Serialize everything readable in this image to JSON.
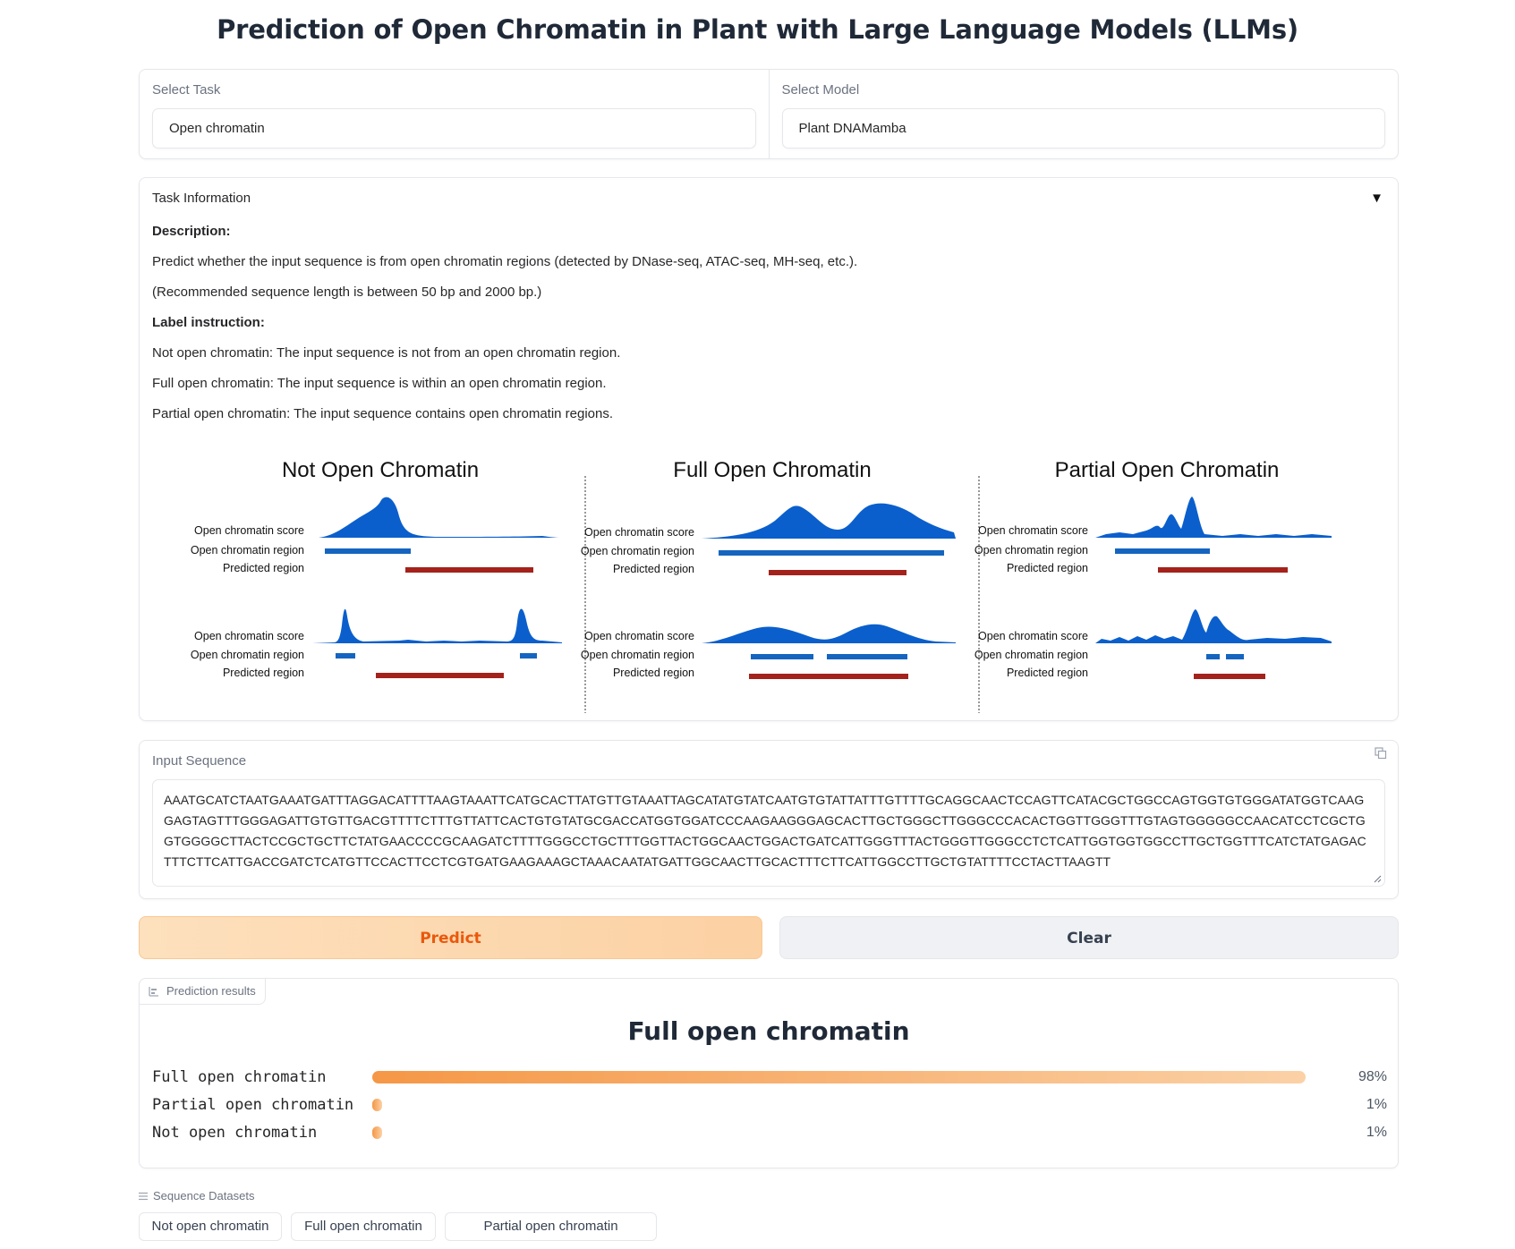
{
  "title": "Prediction of Open Chromatin in Plant with Large Language Models (LLMs)",
  "task_select": {
    "label": "Select Task",
    "value": "Open chromatin"
  },
  "model_select": {
    "label": "Select Model",
    "value": "Plant DNAMamba"
  },
  "task_info": {
    "header": "Task Information",
    "toggle_icon": "triangle-down-icon",
    "description_heading": "Description:",
    "description": "Predict whether the input sequence is from open chromatin regions (detected by DNase-seq, ATAC-seq, MH-seq, etc.).",
    "recommendation": "(Recommended sequence length is between 50 bp and 2000 bp.)",
    "label_heading": "Label instruction:",
    "labels": [
      "Not open chromatin: The input sequence is not from an open chromatin region.",
      "Full open chromatin: The input sequence is within an open chromatin region.",
      "Partial open chromatin: The input sequence contains open chromatin regions."
    ],
    "figure": {
      "panels": [
        "Not Open Chromatin",
        "Full Open Chromatin",
        "Partial Open Chromatin"
      ],
      "track_labels": [
        "Open chromatin score",
        "Open chromatin region",
        "Predicted region"
      ],
      "colors": {
        "score": "#0b5fcc",
        "region": "#1565c0",
        "predicted": "#a4221c"
      }
    }
  },
  "input": {
    "label": "Input Sequence",
    "sequence": "AAATGCATCTAATGAAATGATTTAGGACATTTTAAGTAAATTCATGCACTTATGTTGTAAATTAGCATATGTATCAATGTGTATTATTTGTTTTGCAGGCAACTCCAGTTCATACGCTGGCCAGTGGTGTGGGATATGGTCAAGGAGTAGTTTGGGAGATTGTGTTGACGTTTTCTTTGTTATTCACTGTGTATGCGACCATGGTGGATCCCAAGAAGGGAGCACTTGCTGGGCTTGGGCCCACACTGGTTGGGTTTGTAGTGGGGGCCAACATCCTCGCTGGTGGGGCTTACTCCGCTGCTTCTATGAACCCCGCAAGATCTTTTGGGCCTGCTTTGGTTACTGGCAACTGGACTGATCATTGGGTTTACTGGGTTGGGCCTCTCATTGGTGGTGGCCTTGCTGGTTTCATCTATGAGACTTTCTTCATTGACCGATCTCATGTTCCACTTCCTCGTGATGAAGAAAGCTAAACAATATGATTGGCAACTTGCACTTTCTTCATTGGCCTTGCTGTATTTTCCTACTTAAGTT"
  },
  "buttons": {
    "predict": "Predict",
    "clear": "Clear"
  },
  "results": {
    "tag": "Prediction results",
    "top_label": "Full open chromatin",
    "bars": [
      {
        "label": "Full open chromatin",
        "value": 0.98,
        "pct": "98%"
      },
      {
        "label": "Partial open chromatin",
        "value": 0.01,
        "pct": "1%"
      },
      {
        "label": "Not open chromatin",
        "value": 0.01,
        "pct": "1%"
      }
    ]
  },
  "datasets": {
    "header": "Sequence Datasets",
    "items": [
      "Not open chromatin",
      "Full open chromatin",
      "Partial open chromatin"
    ]
  }
}
